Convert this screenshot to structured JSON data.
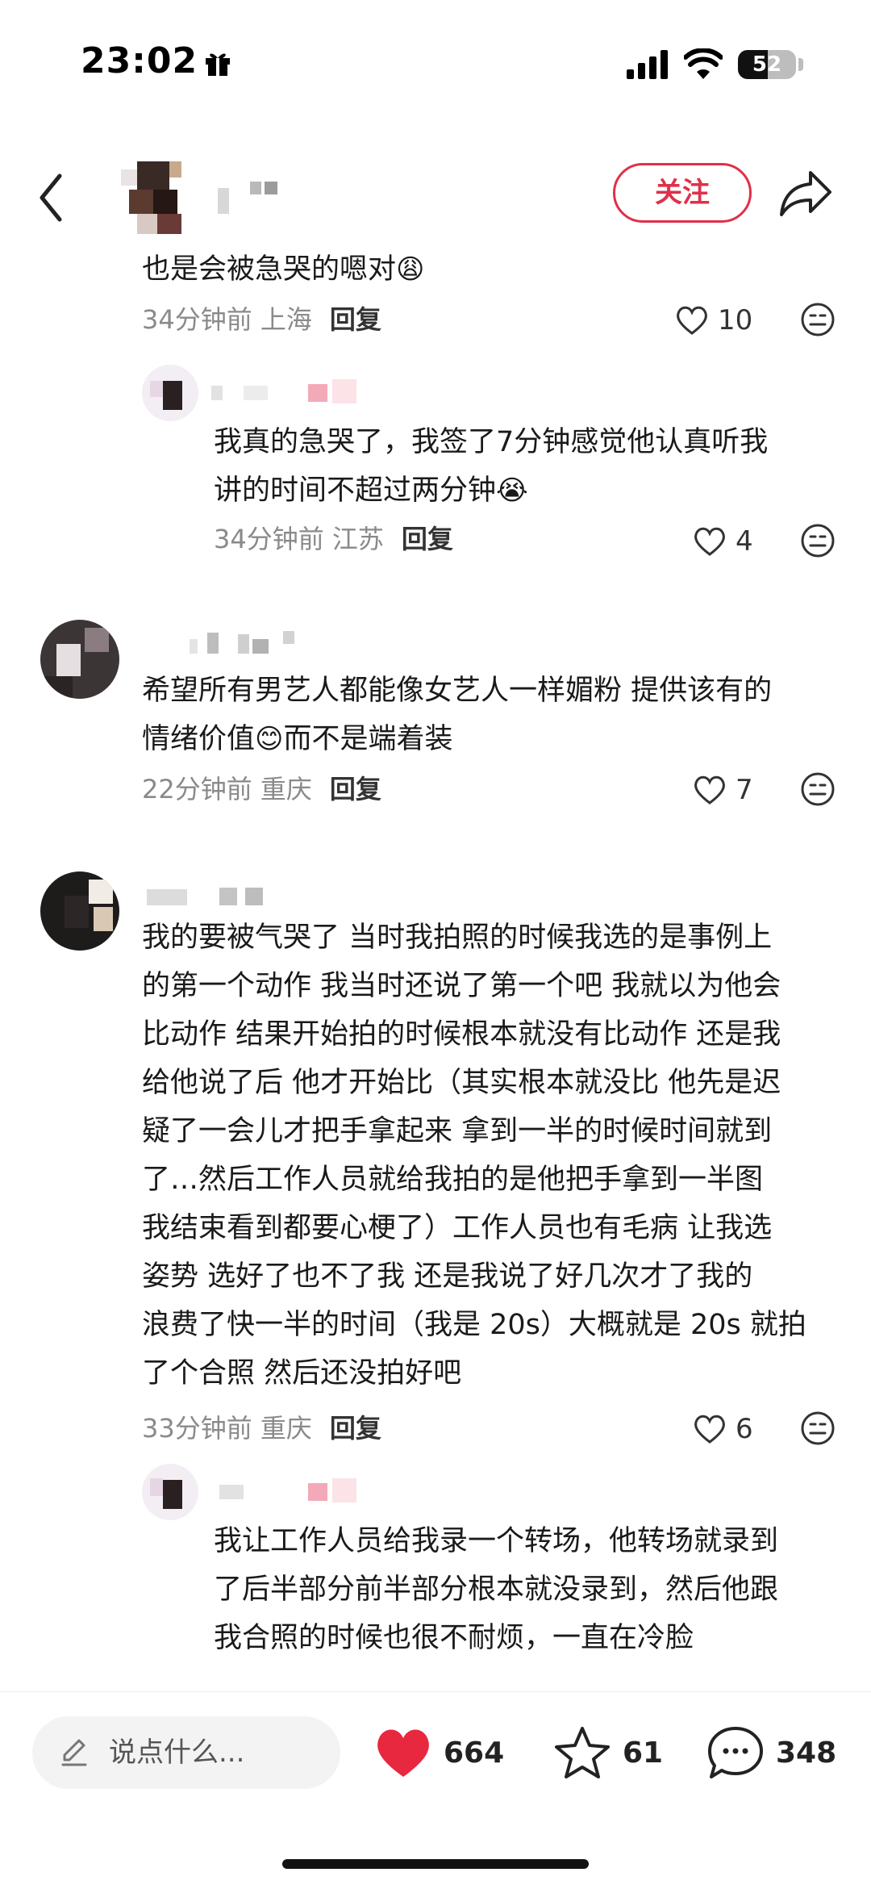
{
  "status_bar": {
    "time": "23:02",
    "battery": "52",
    "battery_level": 0.52
  },
  "header": {
    "follow_label": "关注"
  },
  "comments": [
    {
      "text_lines": [
        "也是会被急哭的嗯对"
      ],
      "emoji": "😩",
      "time": "34分钟前",
      "location": "上海",
      "reply_label": "回复",
      "likes": "10"
    },
    {
      "text_lines": [
        "我真的急哭了，我签了7分钟感觉他认真听我",
        "讲的时间不超过两分钟"
      ],
      "emoji": "😭",
      "time": "34分钟前",
      "location": "江苏",
      "reply_label": "回复",
      "likes": "4"
    },
    {
      "text_lines": [
        "希望所有男艺人都能像女艺人一样媚粉 提供该有的",
        "情绪价值",
        "而不是端着装"
      ],
      "emoji": "😊",
      "time": "22分钟前",
      "location": "重庆",
      "reply_label": "回复",
      "likes": "7"
    },
    {
      "text_lines": [
        "我的要被气哭了 当时我拍照的时候我选的是事例上",
        "的第一个动作 我当时还说了第一个吧 我就以为他会",
        "比动作 结果开始拍的时候根本就没有比动作 还是我",
        "给他说了后 他才开始比（其实根本就没比 他先是迟",
        "疑了一会儿才把手拿起来 拿到一半的时候时间就到",
        "了…然后工作人员就给我拍的是他把手拿到一半图",
        "我结束看到都要心梗了）工作人员也有毛病 让我选",
        "姿势 选好了也不了我 还是我说了好几次才了我的",
        "浪费了快一半的时间（我是 20s）大概就是 20s 就拍",
        "了个合照 然后还没拍好吧"
      ],
      "time": "33分钟前",
      "location": "重庆",
      "reply_label": "回复",
      "likes": "6"
    },
    {
      "text_lines": [
        "我让工作人员给我录一个转场，他转场就录到",
        "了后半部分前半部分根本就没录到，然后他跟",
        "我合照的时候也很不耐烦，一直在冷脸"
      ]
    }
  ],
  "bottom_bar": {
    "placeholder": "说点什么...",
    "likes": "664",
    "stars": "61",
    "comments": "348"
  },
  "colors": {
    "accent": "#e0304a",
    "like_red": "#e8283f"
  }
}
